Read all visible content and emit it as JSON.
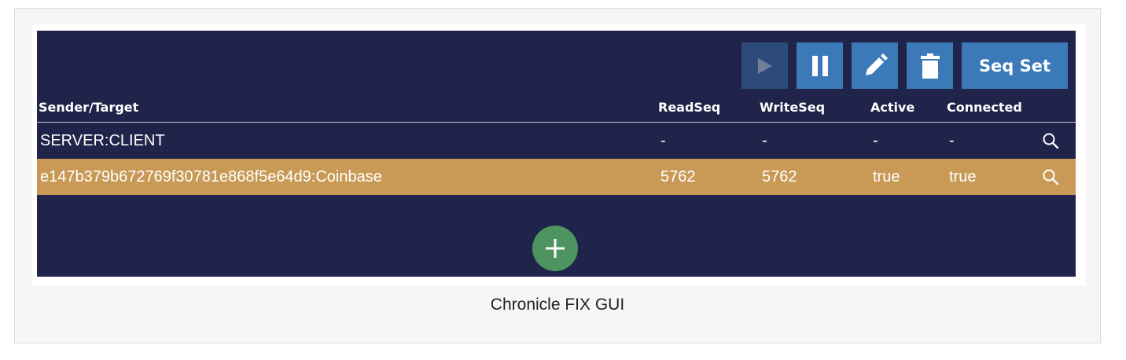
{
  "toolbar": {
    "play_icon": "play-icon",
    "pause_icon": "pause-icon",
    "edit_icon": "pencil-icon",
    "delete_icon": "trash-icon",
    "seq_set_label": "Seq Set"
  },
  "table": {
    "headers": {
      "sender_target": "Sender/Target",
      "read_seq": "ReadSeq",
      "write_seq": "WriteSeq",
      "active": "Active",
      "connected": "Connected"
    },
    "rows": [
      {
        "sender_target": "SERVER:CLIENT",
        "read_seq": "-",
        "write_seq": "-",
        "active": "-",
        "connected": "-",
        "action_icon": "search-icon",
        "selected": false
      },
      {
        "sender_target": "e147b379b672769f30781e868f5e64d9:Coinbase",
        "read_seq": "5762",
        "write_seq": "5762",
        "active": "true",
        "connected": "true",
        "action_icon": "search-icon",
        "selected": true
      }
    ]
  },
  "add_button_icon": "plus-icon",
  "caption": "Chronicle FIX GUI",
  "colors": {
    "panel_bg": "#20244a",
    "button_blue": "#3b79b9",
    "button_disabled": "#2c4a7a",
    "selected_row": "#c89a56",
    "add_green": "#4e9460"
  }
}
